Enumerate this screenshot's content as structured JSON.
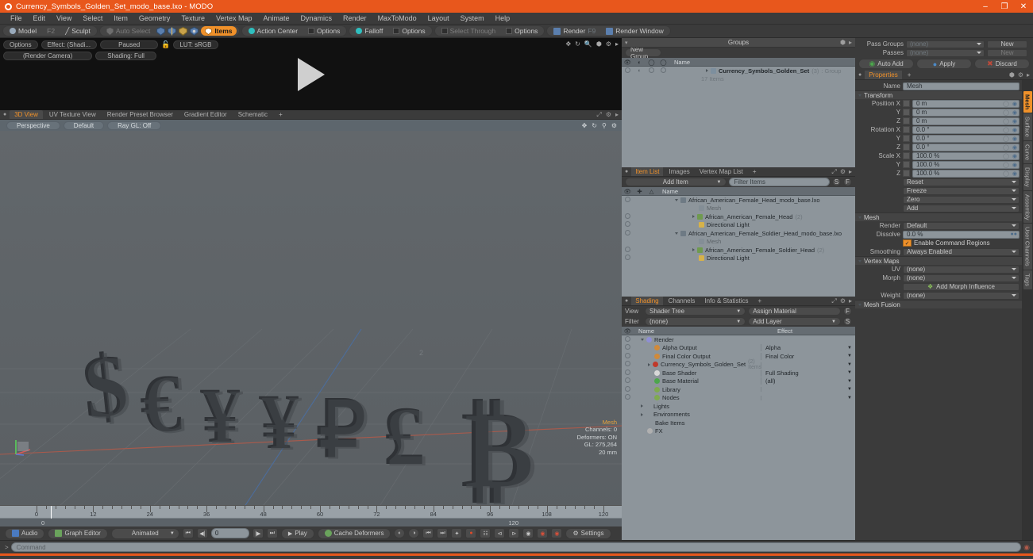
{
  "window": {
    "title": "Currency_Symbols_Golden_Set_modo_base.lxo - MODO",
    "app_icon": "modo-icon",
    "minimize": "–",
    "maximize": "❐",
    "close": "✕",
    "accent_color": "#e8571c"
  },
  "menubar": {
    "items": [
      "File",
      "Edit",
      "View",
      "Select",
      "Item",
      "Geometry",
      "Texture",
      "Vertex Map",
      "Animate",
      "Dynamics",
      "Render",
      "MaxToModo",
      "Layout",
      "System",
      "Help"
    ]
  },
  "modebar": {
    "mode_group": [
      {
        "label": "Model",
        "icon": "sphere-icon",
        "state": "normal"
      },
      {
        "label": "F2",
        "icon": "",
        "state": "dim"
      },
      {
        "label": "Sculpt",
        "icon": "brush-icon",
        "state": "normal"
      }
    ],
    "select_group": [
      {
        "label": "Auto Select",
        "icon": "shield-icon",
        "state": "dim"
      },
      {
        "label": "",
        "icon": "vertices-icon",
        "state": "icon"
      },
      {
        "label": "",
        "icon": "edges-icon",
        "state": "icon"
      },
      {
        "label": "",
        "icon": "polygons-icon",
        "state": "icon"
      },
      {
        "label": "",
        "icon": "materials-icon",
        "state": "icon"
      },
      {
        "label": "Items",
        "icon": "items-icon",
        "state": "active"
      }
    ],
    "action_center": {
      "label": "Action Center",
      "icon": "crosshair-icon"
    },
    "options1": "Options",
    "falloff": {
      "label": "Falloff",
      "icon": "falloff-icon"
    },
    "options2": "Options",
    "select_through": {
      "label": "Select Through",
      "icon": "through-icon"
    },
    "options3": "Options",
    "render": {
      "label": "Render",
      "shortcut": "F9",
      "icon": "render-icon"
    },
    "render_window": {
      "label": "Render Window",
      "icon": "render-window-icon"
    }
  },
  "preview": {
    "options": "Options",
    "effect": "Effect: (Shadi...",
    "paused": "Paused",
    "lock_icon": "unlock-icon",
    "lut": "LUT: sRGB",
    "camera": "(Render Camera)",
    "shading": "Shading: Full",
    "icons": [
      "move-icon",
      "rotate-icon",
      "zoom-icon",
      "fit-icon",
      "gear-icon",
      "arrow-icon"
    ]
  },
  "viewport": {
    "tabs": [
      {
        "label": "3D View",
        "active": true
      },
      {
        "label": "UV Texture View",
        "active": false
      },
      {
        "label": "Render Preset Browser",
        "active": false
      },
      {
        "label": "Gradient Editor",
        "active": false
      },
      {
        "label": "Schematic",
        "active": false
      },
      {
        "label": "+",
        "active": false
      }
    ],
    "tab_icons": [
      "expand-icon",
      "gear-icon",
      "arrow-icon"
    ],
    "controls": [
      "Perspective",
      "Default",
      "Ray GL: Off"
    ],
    "control_icons": [
      "move-icon",
      "rotate-icon",
      "zoom-icon",
      "gear-icon"
    ],
    "info": {
      "title": "Mesh",
      "channels": "Channels: 0",
      "deformers": "Deformers: ON",
      "gl": "GL: 275,264",
      "scale": "20 mm"
    },
    "scene_description": "3D currency symbols: dollar, euro, yen, yuan, ruble, pound, bitcoin"
  },
  "timeline": {
    "ticks": [
      0,
      12,
      24,
      36,
      48,
      60,
      72,
      84,
      96,
      108,
      120
    ],
    "start": "0",
    "end": "120",
    "playhead": 0
  },
  "bottombar": {
    "audio": "Audio",
    "graph_editor": "Graph Editor",
    "animated": "Animated",
    "frame_value": "0",
    "play": "Play",
    "cache_deformers": "Cache Deformers",
    "settings": "Settings",
    "transport_icons": [
      "first-frame-icon",
      "prev-frame-icon",
      "next-frame-icon",
      "last-frame-icon"
    ],
    "extra_icons": [
      "ghost-a-icon",
      "ghost-b-icon",
      "key-prev-icon",
      "key-next-icon",
      "auto-key-icon",
      "record-icon",
      "key-options-icon",
      "range-start-icon",
      "range-end-icon",
      "channel-a-icon",
      "channel-b-icon",
      "channel-c-icon"
    ]
  },
  "groups_panel": {
    "title": "Groups",
    "header_icons": [
      "expand-icon",
      "arrow-icon"
    ],
    "new_group_button": "New Group",
    "columns": [
      "eye",
      "render",
      "lock",
      "select",
      "Name"
    ],
    "rows": [
      {
        "name": "Currency_Symbols_Golden_Set",
        "count": "(3)",
        "type": ": Group",
        "sub": "17 Items",
        "icon": "group-icon"
      }
    ]
  },
  "item_list": {
    "tabs": [
      {
        "label": "Item List",
        "active": true
      },
      {
        "label": "Images",
        "active": false
      },
      {
        "label": "Vertex Map List",
        "active": false
      },
      {
        "label": "+",
        "active": false
      }
    ],
    "tab_icons": [
      "expand-icon",
      "gear-icon",
      "arrow-icon"
    ],
    "add_item": "Add Item",
    "filter_items": "Filter Items",
    "btn_s": "S",
    "btn_f": "F",
    "columns": [
      "eye",
      "lock",
      "layer",
      "Name"
    ],
    "rows": [
      {
        "indent": 1,
        "label": "African_American_Female_Head_modo_base.lxo",
        "icon": "scene-icon",
        "expander": "down",
        "dim": false
      },
      {
        "indent": 2,
        "label": "Mesh",
        "icon": "mesh-icon",
        "expander": "",
        "dim": true
      },
      {
        "indent": 2,
        "label": "African_American_Female_Head",
        "suffix": "(2)",
        "icon": "folder-icon",
        "expander": "right",
        "dim": false
      },
      {
        "indent": 2,
        "label": "Directional Light",
        "icon": "light-icon",
        "expander": "",
        "dim": false
      },
      {
        "indent": 1,
        "label": "African_American_Female_Soldier_Head_modo_base.lxo",
        "icon": "scene-icon",
        "expander": "down",
        "dim": false
      },
      {
        "indent": 2,
        "label": "Mesh",
        "icon": "mesh-icon",
        "expander": "",
        "dim": true
      },
      {
        "indent": 2,
        "label": "African_American_Female_Soldier_Head",
        "suffix": "(2)",
        "icon": "folder-icon",
        "expander": "right",
        "dim": false
      },
      {
        "indent": 2,
        "label": "Directional Light",
        "icon": "light-icon",
        "expander": "",
        "dim": false
      }
    ]
  },
  "shading_panel": {
    "tabs": [
      {
        "label": "Shading",
        "active": true
      },
      {
        "label": "Channels",
        "active": false
      },
      {
        "label": "Info & Statistics",
        "active": false
      },
      {
        "label": "+",
        "active": false
      }
    ],
    "tab_icons": [
      "expand-icon",
      "gear-icon",
      "arrow-icon"
    ],
    "view_label": "View",
    "view_value": "Shader Tree",
    "assign_material": "Assign Material",
    "btn_f": "F",
    "filter_label": "Filter",
    "filter_value": "(none)",
    "add_layer": "Add Layer",
    "btn_s": "S",
    "col_name": "Name",
    "col_effect": "Effect",
    "rows": [
      {
        "indent": 1,
        "label": "Render",
        "icon": "render-globe-icon",
        "color": "#8f8fd4",
        "expander": "down",
        "effect": ""
      },
      {
        "indent": 2,
        "label": "Alpha Output",
        "icon": "output-icon",
        "color": "#d08a3a",
        "expander": "",
        "effect": "Alpha"
      },
      {
        "indent": 2,
        "label": "Final Color Output",
        "icon": "output-icon",
        "color": "#d08a3a",
        "expander": "",
        "effect": "Final Color"
      },
      {
        "indent": 2,
        "label": "Currency_Symbols_Golden_Set",
        "suffix": "(2) Items",
        "icon": "material-icon",
        "color": "#c0392b",
        "expander": "right",
        "effect": ""
      },
      {
        "indent": 2,
        "label": "Base Shader",
        "icon": "shader-icon",
        "color": "#d8d8d8",
        "expander": "",
        "effect": "Full Shading"
      },
      {
        "indent": 2,
        "label": "Base Material",
        "icon": "material-green-icon",
        "color": "#4ca64c",
        "expander": "",
        "effect": "(all)"
      },
      {
        "indent": 2,
        "label": "Library",
        "icon": "folder-icon",
        "color": "#7faa4f",
        "expander": "",
        "effect": ""
      },
      {
        "indent": 2,
        "label": "Nodes",
        "icon": "folder-icon",
        "color": "#7faa4f",
        "expander": "",
        "effect": ""
      },
      {
        "indent": 1,
        "label": "Lights",
        "icon": "",
        "color": "",
        "expander": "right",
        "effect": ""
      },
      {
        "indent": 1,
        "label": "Environments",
        "icon": "",
        "color": "",
        "expander": "right",
        "effect": ""
      },
      {
        "indent": 1,
        "label": "Bake Items",
        "icon": "",
        "color": "",
        "expander": "",
        "effect": ""
      },
      {
        "indent": 1,
        "label": "FX",
        "icon": "fx-icon",
        "color": "#b0b0b0",
        "expander": "",
        "effect": ""
      }
    ]
  },
  "properties": {
    "pass_groups_label": "Pass Groups",
    "pass_groups_value": "(none)",
    "pass_groups_new": "New",
    "passes_label": "Passes",
    "passes_value": "(none)",
    "passes_new": "New",
    "auto_add": "Auto Add",
    "apply": "Apply",
    "discard": "Discard",
    "tab_label": "Properties",
    "tab_plus": "+",
    "tab_icons": [
      "expand-icon",
      "gear-icon",
      "arrow-icon"
    ],
    "name_label": "Name",
    "name_value": "Mesh",
    "transform_section": "Transform",
    "transform_rows": [
      {
        "label": "Position X",
        "value": "0 m"
      },
      {
        "label": "Y",
        "value": "0 m"
      },
      {
        "label": "Z",
        "value": "0 m"
      },
      {
        "label": "Rotation X",
        "value": "0.0 °"
      },
      {
        "label": "Y",
        "value": "0.0 °"
      },
      {
        "label": "Z",
        "value": "0.0 °"
      },
      {
        "label": "Scale X",
        "value": "100.0 %"
      },
      {
        "label": "Y",
        "value": "100.0 %"
      },
      {
        "label": "Z",
        "value": "100.0 %"
      }
    ],
    "transform_menus": [
      "Reset",
      "Freeze",
      "Zero",
      "Add"
    ],
    "mesh_section": "Mesh",
    "render_label": "Render",
    "render_value": "Default",
    "dissolve_label": "Dissolve",
    "dissolve_value": "0.0 %",
    "enable_command_regions": "Enable Command Regions",
    "smoothing_label": "Smoothing",
    "smoothing_value": "Always Enabled",
    "vertex_maps_section": "Vertex Maps",
    "uv_label": "UV",
    "uv_value": "(none)",
    "morph_label": "Morph",
    "morph_value": "(none)",
    "add_morph_influence": "Add Morph Influence",
    "weight_label": "Weight",
    "weight_value": "(none)",
    "mesh_fusion_section": "Mesh Fusion",
    "vertical_tabs": [
      {
        "label": "Mesh",
        "active": true
      },
      {
        "label": "Surface",
        "active": false
      },
      {
        "label": "Curve",
        "active": false
      },
      {
        "label": "Display",
        "active": false
      },
      {
        "label": "Assembly",
        "active": false
      },
      {
        "label": "User Channels",
        "active": false
      },
      {
        "label": "Tags",
        "active": false
      }
    ]
  },
  "command_bar": {
    "prompt": ">",
    "placeholder": "Command",
    "record_icon": "record-icon"
  }
}
